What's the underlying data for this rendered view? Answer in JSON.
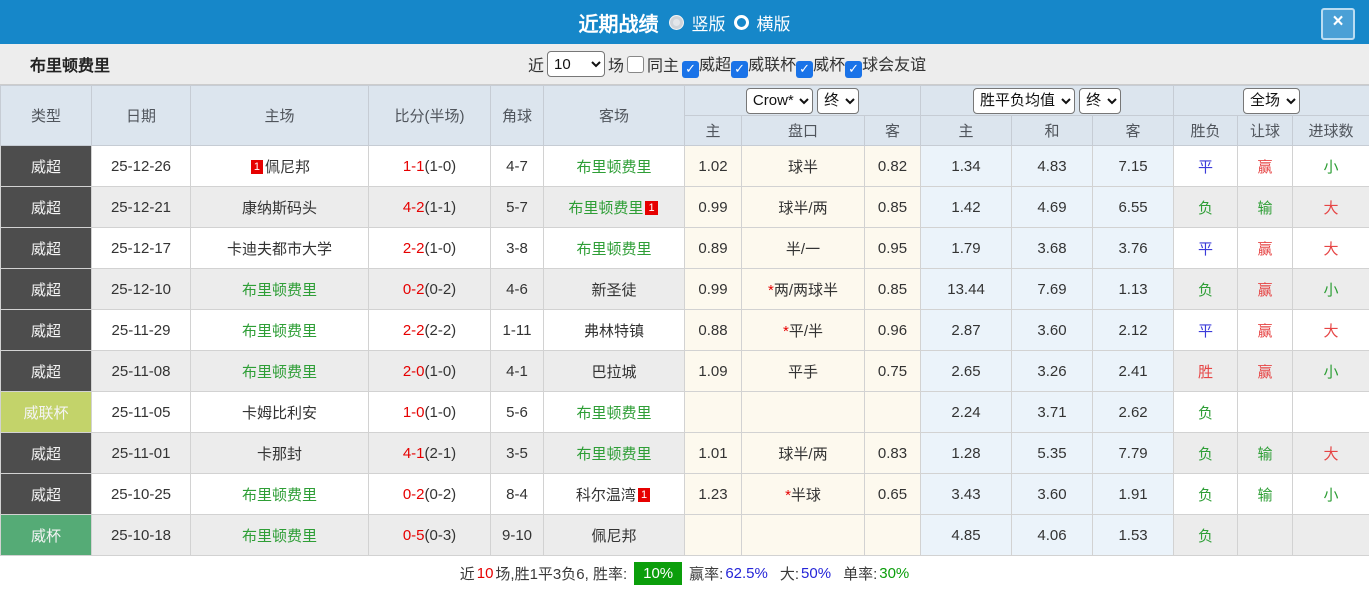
{
  "colors": {
    "header_blue": "#1687c9",
    "type_super_bg": "#4d4d4d",
    "type_leaguecup_bg": "#c3d36a",
    "type_cup_bg": "#55ab76",
    "green_text": "#2e9e36",
    "red_text": "#e64545",
    "blue_text": "#3b3bd9",
    "score_red": "#e60000",
    "badge_red": "#e60000",
    "odds_bg": "#fdf9ee",
    "avg_bg": "#ebf3fa",
    "rate_badge_bg": "#0b9e0b",
    "value_blue": "#2525d8",
    "value_green": "#0a9e0a"
  },
  "titlebar": {
    "title": "近期战绩",
    "radio_vertical_label": "竖版",
    "radio_horizontal_label": "横版",
    "close_label": "×"
  },
  "filterbar": {
    "team": "布里顿费里",
    "recent_label": "近",
    "recent_value": "10",
    "matches_label": "场",
    "same_home_label": "同主",
    "league_checkboxes": [
      {
        "label": "威超",
        "checked": true
      },
      {
        "label": "威联杯",
        "checked": true
      },
      {
        "label": "威杯",
        "checked": true
      },
      {
        "label": "球会友谊",
        "checked": true
      }
    ],
    "check_glyph": "✓"
  },
  "table": {
    "left_headers": [
      "类型",
      "日期",
      "主场",
      "比分(半场)",
      "角球",
      "客场"
    ],
    "group1": {
      "select1": "Crow*",
      "select2": "终",
      "cols": [
        "主",
        "盘口",
        "客"
      ]
    },
    "group2": {
      "select1": "胜平负均值",
      "select2": "终",
      "cols": [
        "主",
        "和",
        "客"
      ]
    },
    "group3": {
      "select1": "全场",
      "cols": [
        "胜负",
        "让球",
        "进球数"
      ]
    },
    "rows": [
      {
        "type": "威超",
        "type_key": "super",
        "date": "25-12-26",
        "home": {
          "name": "佩尼邦",
          "green": false,
          "badge": "1",
          "badge_pos": "before"
        },
        "score_ft": "1-1",
        "score_ht": "(1-0)",
        "corners": "4-7",
        "away": {
          "name": "布里顿费里",
          "green": true,
          "badge": "",
          "badge_pos": ""
        },
        "odds_home": "1.02",
        "handicap": "球半",
        "handicap_star": false,
        "odds_away": "0.82",
        "avg_home": "1.34",
        "avg_draw": "4.83",
        "avg_away": "7.15",
        "result_wdl": {
          "t": "平",
          "c": "blue"
        },
        "result_handicap": {
          "t": "赢",
          "c": "red"
        },
        "result_goals": {
          "t": "小",
          "c": "green"
        }
      },
      {
        "type": "威超",
        "type_key": "super",
        "date": "25-12-21",
        "home": {
          "name": "康纳斯码头",
          "green": false,
          "badge": "",
          "badge_pos": ""
        },
        "score_ft": "4-2",
        "score_ht": "(1-1)",
        "corners": "5-7",
        "away": {
          "name": "布里顿费里",
          "green": true,
          "badge": "1",
          "badge_pos": "after"
        },
        "odds_home": "0.99",
        "handicap": "球半/两",
        "handicap_star": false,
        "odds_away": "0.85",
        "avg_home": "1.42",
        "avg_draw": "4.69",
        "avg_away": "6.55",
        "result_wdl": {
          "t": "负",
          "c": "green"
        },
        "result_handicap": {
          "t": "输",
          "c": "green"
        },
        "result_goals": {
          "t": "大",
          "c": "red"
        }
      },
      {
        "type": "威超",
        "type_key": "super",
        "date": "25-12-17",
        "home": {
          "name": "卡迪夫都市大学",
          "green": false,
          "badge": "",
          "badge_pos": ""
        },
        "score_ft": "2-2",
        "score_ht": "(1-0)",
        "corners": "3-8",
        "away": {
          "name": "布里顿费里",
          "green": true,
          "badge": "",
          "badge_pos": ""
        },
        "odds_home": "0.89",
        "handicap": "半/一",
        "handicap_star": false,
        "odds_away": "0.95",
        "avg_home": "1.79",
        "avg_draw": "3.68",
        "avg_away": "3.76",
        "result_wdl": {
          "t": "平",
          "c": "blue"
        },
        "result_handicap": {
          "t": "赢",
          "c": "red"
        },
        "result_goals": {
          "t": "大",
          "c": "red"
        }
      },
      {
        "type": "威超",
        "type_key": "super",
        "date": "25-12-10",
        "home": {
          "name": "布里顿费里",
          "green": true,
          "badge": "",
          "badge_pos": ""
        },
        "score_ft": "0-2",
        "score_ht": "(0-2)",
        "corners": "4-6",
        "away": {
          "name": "新圣徒",
          "green": false,
          "badge": "",
          "badge_pos": ""
        },
        "odds_home": "0.99",
        "handicap": "两/两球半",
        "handicap_star": true,
        "odds_away": "0.85",
        "avg_home": "13.44",
        "avg_draw": "7.69",
        "avg_away": "1.13",
        "result_wdl": {
          "t": "负",
          "c": "green"
        },
        "result_handicap": {
          "t": "赢",
          "c": "red"
        },
        "result_goals": {
          "t": "小",
          "c": "green"
        }
      },
      {
        "type": "威超",
        "type_key": "super",
        "date": "25-11-29",
        "home": {
          "name": "布里顿费里",
          "green": true,
          "badge": "",
          "badge_pos": ""
        },
        "score_ft": "2-2",
        "score_ht": "(2-2)",
        "corners": "1-11",
        "away": {
          "name": "弗林特镇",
          "green": false,
          "badge": "",
          "badge_pos": ""
        },
        "odds_home": "0.88",
        "handicap": "平/半",
        "handicap_star": true,
        "odds_away": "0.96",
        "avg_home": "2.87",
        "avg_draw": "3.60",
        "avg_away": "2.12",
        "result_wdl": {
          "t": "平",
          "c": "blue"
        },
        "result_handicap": {
          "t": "赢",
          "c": "red"
        },
        "result_goals": {
          "t": "大",
          "c": "red"
        }
      },
      {
        "type": "威超",
        "type_key": "super",
        "date": "25-11-08",
        "home": {
          "name": "布里顿费里",
          "green": true,
          "badge": "",
          "badge_pos": ""
        },
        "score_ft": "2-0",
        "score_ht": "(1-0)",
        "corners": "4-1",
        "away": {
          "name": "巴拉城",
          "green": false,
          "badge": "",
          "badge_pos": ""
        },
        "odds_home": "1.09",
        "handicap": "平手",
        "handicap_star": false,
        "odds_away": "0.75",
        "avg_home": "2.65",
        "avg_draw": "3.26",
        "avg_away": "2.41",
        "result_wdl": {
          "t": "胜",
          "c": "red"
        },
        "result_handicap": {
          "t": "赢",
          "c": "red"
        },
        "result_goals": {
          "t": "小",
          "c": "green"
        }
      },
      {
        "type": "威联杯",
        "type_key": "leaguecup",
        "date": "25-11-05",
        "home": {
          "name": "卡姆比利安",
          "green": false,
          "badge": "",
          "badge_pos": ""
        },
        "score_ft": "1-0",
        "score_ht": "(1-0)",
        "corners": "5-6",
        "away": {
          "name": "布里顿费里",
          "green": true,
          "badge": "",
          "badge_pos": ""
        },
        "odds_home": "",
        "handicap": "",
        "handicap_star": false,
        "odds_away": "",
        "avg_home": "2.24",
        "avg_draw": "3.71",
        "avg_away": "2.62",
        "result_wdl": {
          "t": "负",
          "c": "green"
        },
        "result_handicap": {
          "t": "",
          "c": ""
        },
        "result_goals": {
          "t": "",
          "c": ""
        }
      },
      {
        "type": "威超",
        "type_key": "super",
        "date": "25-11-01",
        "home": {
          "name": "卡那封",
          "green": false,
          "badge": "",
          "badge_pos": ""
        },
        "score_ft": "4-1",
        "score_ht": "(2-1)",
        "corners": "3-5",
        "away": {
          "name": "布里顿费里",
          "green": true,
          "badge": "",
          "badge_pos": ""
        },
        "odds_home": "1.01",
        "handicap": "球半/两",
        "handicap_star": false,
        "odds_away": "0.83",
        "avg_home": "1.28",
        "avg_draw": "5.35",
        "avg_away": "7.79",
        "result_wdl": {
          "t": "负",
          "c": "green"
        },
        "result_handicap": {
          "t": "输",
          "c": "green"
        },
        "result_goals": {
          "t": "大",
          "c": "red"
        }
      },
      {
        "type": "威超",
        "type_key": "super",
        "date": "25-10-25",
        "home": {
          "name": "布里顿费里",
          "green": true,
          "badge": "",
          "badge_pos": ""
        },
        "score_ft": "0-2",
        "score_ht": "(0-2)",
        "corners": "8-4",
        "away": {
          "name": "科尔温湾",
          "green": false,
          "badge": "1",
          "badge_pos": "after"
        },
        "odds_home": "1.23",
        "handicap": "半球",
        "handicap_star": true,
        "odds_away": "0.65",
        "avg_home": "3.43",
        "avg_draw": "3.60",
        "avg_away": "1.91",
        "result_wdl": {
          "t": "负",
          "c": "green"
        },
        "result_handicap": {
          "t": "输",
          "c": "green"
        },
        "result_goals": {
          "t": "小",
          "c": "green"
        }
      },
      {
        "type": "威杯",
        "type_key": "cup",
        "date": "25-10-18",
        "home": {
          "name": "布里顿费里",
          "green": true,
          "badge": "",
          "badge_pos": ""
        },
        "score_ft": "0-5",
        "score_ht": "(0-3)",
        "corners": "9-10",
        "away": {
          "name": "佩尼邦",
          "green": false,
          "badge": "",
          "badge_pos": ""
        },
        "odds_home": "",
        "handicap": "",
        "handicap_star": false,
        "odds_away": "",
        "avg_home": "4.85",
        "avg_draw": "4.06",
        "avg_away": "1.53",
        "result_wdl": {
          "t": "负",
          "c": "green"
        },
        "result_handicap": {
          "t": "",
          "c": ""
        },
        "result_goals": {
          "t": "",
          "c": ""
        }
      }
    ]
  },
  "summary": {
    "prefix": "近",
    "count": "10",
    "mid": "场,胜1平3负6, 胜率:",
    "rate_badge": "10%",
    "win_label": "赢率:",
    "win_value": "62.5%",
    "big_label": "大:",
    "big_value": "50%",
    "single_label": "单率:",
    "single_value": "30%"
  }
}
